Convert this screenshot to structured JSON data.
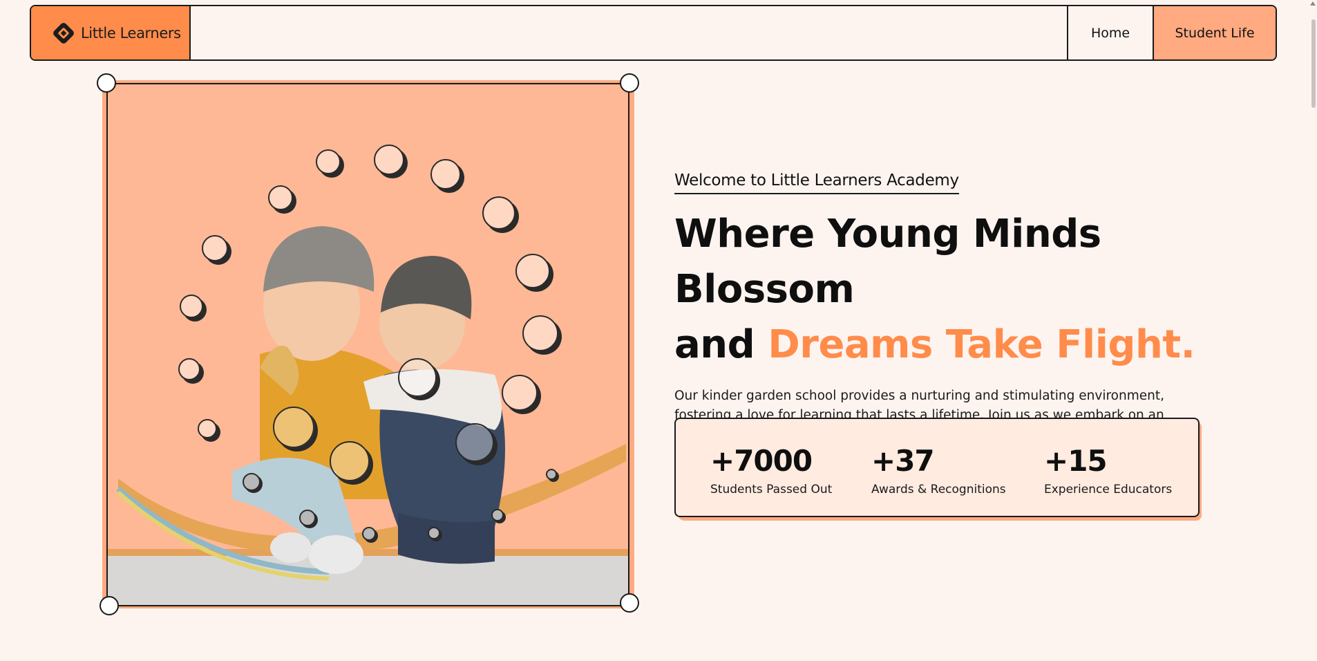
{
  "nav": {
    "brand": "Little Learners",
    "links": [
      "Home",
      "Student Life"
    ]
  },
  "hero": {
    "eyebrow": "Welcome to Little Learners Academy",
    "headline_line1": "Where Young Minds Blossom",
    "headline_and": "and ",
    "headline_accent": "Dreams Take Flight.",
    "description": "Our kinder garden school provides a nurturing and stimulating environment, fostering a love for learning that lasts a lifetime. Join us as we embark on an exciting educational journey together!"
  },
  "stats": [
    {
      "value": "+7000",
      "label": "Students Passed Out"
    },
    {
      "value": "+37",
      "label": "Awards & Recognitions"
    },
    {
      "value": "+15",
      "label": "Experience Educators"
    }
  ],
  "colors": {
    "accent": "#ff8c4b",
    "accent_light": "#ffaa80",
    "background": "#fdf4f0",
    "photo_bg": "#ffb895"
  },
  "icons": {
    "brand_logo": "diamond-logo-icon"
  }
}
